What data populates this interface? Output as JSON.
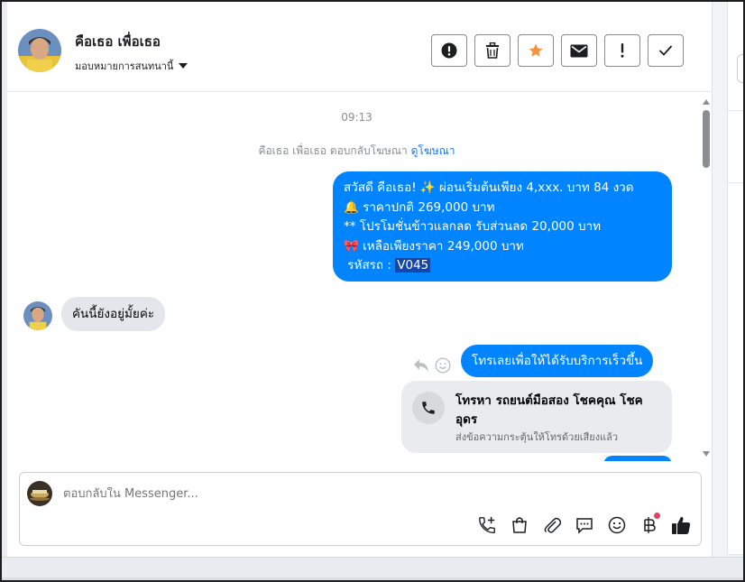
{
  "header": {
    "contact_name": "คือเธอ เพื่อเธอ",
    "assign_label": "มอบหมายการสนทนานี้",
    "toolbar": [
      {
        "name": "spam-button",
        "icon": "exclamation-circle-icon"
      },
      {
        "name": "delete-button",
        "icon": "trash-icon"
      },
      {
        "name": "star-button",
        "icon": "star-icon"
      },
      {
        "name": "mark-unread-button",
        "icon": "envelope-icon"
      },
      {
        "name": "follow-up-button",
        "icon": "exclamation-icon"
      },
      {
        "name": "mark-done-button",
        "icon": "checkmark-icon"
      }
    ],
    "star_color": "#f7923a"
  },
  "conversation": {
    "time_separator": "09:13",
    "reply_note": {
      "text": "คือเธอ เพื่อเธอ ตอบกลับโฆษณา",
      "link": "ดูโฆษณา"
    },
    "messages": [
      {
        "direction": "outgoing",
        "lines": [
          "สวัสดี คือเธอ! ✨  ผ่อนเริ่มต้นเพียง 4,xxx. บาท 84 งวด",
          "🔔 ราคาปกติ  269,000 บาท",
          "** โปรโมชั่นข้าวแลกลด รับส่วนลด 20,000 บาท",
          "🎀  เหลือเพียงราคา 249,000 บาท"
        ],
        "code_label": " รหัสรถ : ",
        "code_value": "V045"
      },
      {
        "direction": "incoming",
        "text": "คันนี้ยังอยู่มั้ยค่ะ"
      },
      {
        "direction": "outgoing",
        "text": "โทรเลยเพื่อให้ได้รับบริการเร็วขึ้น"
      }
    ],
    "call_card": {
      "title": "โทรหา รถยนต์มือสอง โชคคุณ โชค อุดร",
      "subtitle": "ส่งข้อความกระตุ้นให้โทรด้วยเสียงแล้ว"
    }
  },
  "composer": {
    "placeholder": "ตอบกลับใน Messenger...",
    "tools": [
      "phone-plus-icon",
      "shopping-bag-icon",
      "paperclip-icon",
      "chat-bubble-icon",
      "smiley-icon",
      "baht-icon",
      "thumbs-up-icon"
    ]
  },
  "colors": {
    "accent": "#0084ff",
    "incoming_bubble": "#e4e6eb",
    "link": "#1877f2",
    "highlight": "#1547a8"
  }
}
